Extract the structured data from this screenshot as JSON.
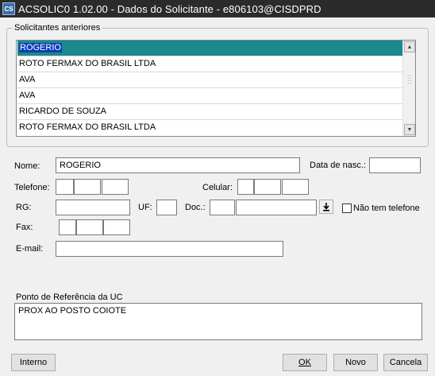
{
  "window": {
    "icon_text": "CS",
    "title": "ACSOLIC0 1.02.00 - Dados do Solicitante  - e806103@CISDPRD"
  },
  "previous_requesters": {
    "label": "Solicitantes anteriores",
    "items": [
      "ROGERIO",
      "ROTO FERMAX DO BRASIL LTDA",
      "AVA",
      "AVA",
      "RICARDO DE SOUZA",
      "ROTO FERMAX DO BRASIL LTDA"
    ],
    "selected_index": 0
  },
  "form": {
    "nome_label": "Nome:",
    "nome_value": "ROGERIO",
    "data_nasc_label": "Data de nasc.:",
    "data_nasc_value": "",
    "telefone_label": "Telefone:",
    "celular_label": "Celular:",
    "rg_label": "RG:",
    "uf_label": "UF:",
    "doc_label": "Doc.:",
    "nao_tem_telefone_label": "Não tem telefone",
    "nao_tem_telefone_checked": false,
    "fax_label": "Fax:",
    "email_label": "E-mail:",
    "email_value": ""
  },
  "reference": {
    "label": "Ponto de Referência da UC",
    "value": "PROX AO POSTO COIOTE"
  },
  "buttons": {
    "interno": "Interno",
    "ok": "OK",
    "novo": "Novo",
    "cancela": "Cancela"
  },
  "icons": {
    "app": "app-icon",
    "scroll_up": "scroll-up-arrow-icon",
    "scroll_down": "scroll-down-arrow-icon",
    "dropdown": "download-arrow-icon"
  }
}
